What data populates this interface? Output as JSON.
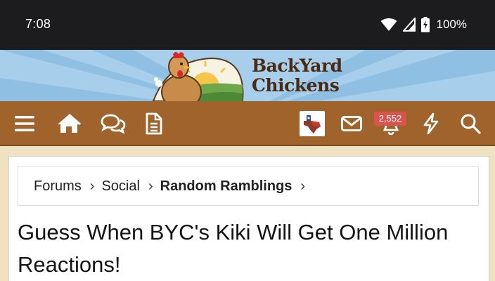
{
  "status_bar": {
    "time": "7:08",
    "battery": "100%",
    "icons": [
      "wifi-icon",
      "signal-icon",
      "battery-charging-icon"
    ]
  },
  "banner": {
    "logo_line1": "BackYard",
    "logo_line2": "Chickens"
  },
  "navbar": {
    "icons": [
      "menu-icon",
      "home-icon",
      "chat-bubbles-icon",
      "document-icon",
      "avatar",
      "mail-icon",
      "bell-icon",
      "lightning-icon",
      "search-icon"
    ],
    "alerts_count": "2,552",
    "colors": {
      "bar": "#a0632c",
      "badge": "#d9534f"
    }
  },
  "breadcrumb": {
    "items": [
      "Forums",
      "Social",
      "Random Ramblings"
    ]
  },
  "thread": {
    "title": "Guess When BYC's Kiki Will Get One Million Reactions!"
  }
}
